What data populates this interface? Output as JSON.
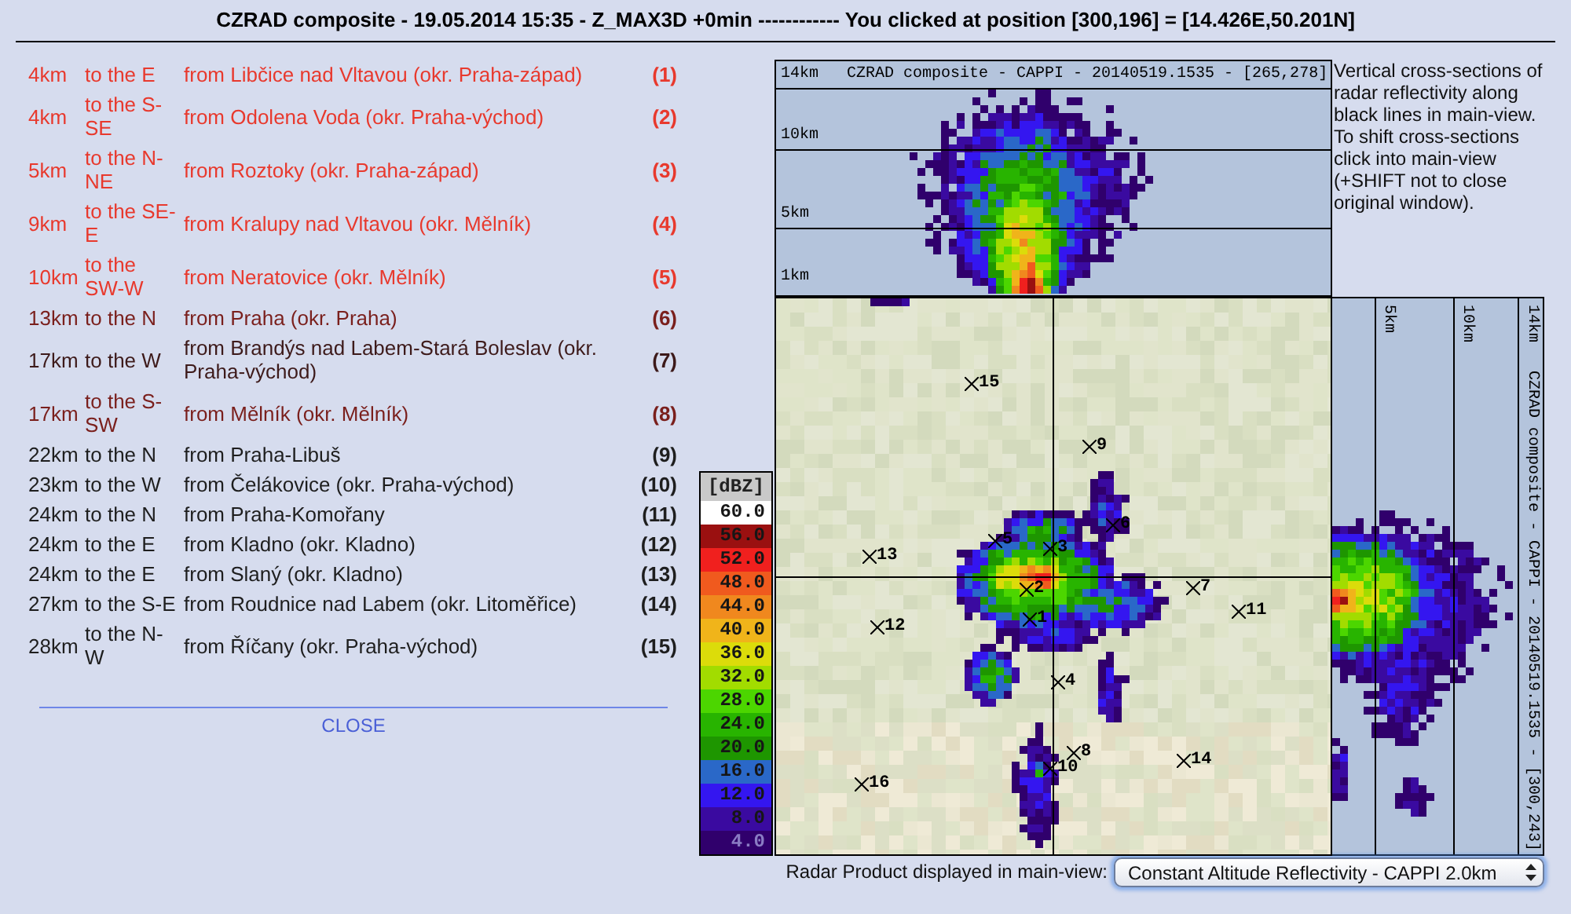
{
  "title": "CZRAD composite - 19.05.2014 15:35 - Z_MAX3D +0min ------------ You clicked at position [300,196] = [14.426E,50.201N]",
  "places": [
    {
      "distance": "4km",
      "direction": "to the E",
      "place": "from Libčice nad Vltavou (okr. Praha-západ)",
      "index": "(1)",
      "color": "#e8392d"
    },
    {
      "distance": "4km",
      "direction": "to the S-SE",
      "place": "from Odolena Voda (okr. Praha-východ)",
      "index": "(2)",
      "color": "#e8392d"
    },
    {
      "distance": "5km",
      "direction": "to the N-NE",
      "place": "from Roztoky (okr. Praha-západ)",
      "index": "(3)",
      "color": "#e8392d"
    },
    {
      "distance": "9km",
      "direction": "to the SE-E",
      "place": "from Kralupy nad Vltavou (okr. Mělník)",
      "index": "(4)",
      "color": "#e8392d"
    },
    {
      "distance": "10km",
      "direction": "to the SW-W",
      "place": "from Neratovice (okr. Mělník)",
      "index": "(5)",
      "color": "#e8392d"
    },
    {
      "distance": "13km",
      "direction": "to the N",
      "place": "from Praha (okr. Praha)",
      "index": "(6)",
      "color": "#7a1f1c"
    },
    {
      "distance": "17km",
      "direction": "to the W",
      "place": "from Brandýs nad Labem-Stará Boleslav (okr. Praha-východ)",
      "index": "(7)",
      "color": "#3d1a1a"
    },
    {
      "distance": "17km",
      "direction": "to the S-SW",
      "place": "from Mělník (okr. Mělník)",
      "index": "(8)",
      "color": "#7a1f1c"
    },
    {
      "distance": "22km",
      "direction": "to the N",
      "place": "from Praha-Libuš",
      "index": "(9)",
      "color": "#1e1e1e"
    },
    {
      "distance": "23km",
      "direction": "to the W",
      "place": "from Čelákovice (okr. Praha-východ)",
      "index": "(10)",
      "color": "#1e1e1e"
    },
    {
      "distance": "24km",
      "direction": "to the N",
      "place": "from Praha-Komořany",
      "index": "(11)",
      "color": "#1e1e1e"
    },
    {
      "distance": "24km",
      "direction": "to the E",
      "place": "from Kladno (okr. Kladno)",
      "index": "(12)",
      "color": "#1e1e1e"
    },
    {
      "distance": "24km",
      "direction": "to the E",
      "place": "from Slaný (okr. Kladno)",
      "index": "(13)",
      "color": "#1e1e1e"
    },
    {
      "distance": "27km",
      "direction": "to the S-E",
      "place": "from Roudnice nad Labem (okr. Litoměřice)",
      "index": "(14)",
      "color": "#1e1e1e"
    },
    {
      "distance": "28km",
      "direction": "to the N-W",
      "place": "from Říčany (okr. Praha-východ)",
      "index": "(15)",
      "color": "#1e1e1e"
    }
  ],
  "close_link": "CLOSE",
  "top_section": {
    "scale_top": "14km",
    "title": "CZRAD composite - CAPPI - 20140519.1535 - [265,278]",
    "altitude_labels": [
      "10km",
      "5km",
      "1km"
    ]
  },
  "description": "Vertical cross-sections of radar reflectivity along black lines in main-view. To shift cross-sections click into main-view (+SHIFT not to close original window).",
  "legend": {
    "title": "[dBZ]",
    "entries": [
      {
        "value": "60.0",
        "color": "#ffffff"
      },
      {
        "value": "56.0",
        "color": "#9a1010"
      },
      {
        "value": "52.0",
        "color": "#f0201e"
      },
      {
        "value": "48.0",
        "color": "#f05a1e"
      },
      {
        "value": "44.0",
        "color": "#f0881e"
      },
      {
        "value": "40.0",
        "color": "#f0b41a"
      },
      {
        "value": "36.0",
        "color": "#dcdc0a"
      },
      {
        "value": "32.0",
        "color": "#a2dc00"
      },
      {
        "value": "28.0",
        "color": "#4cd600"
      },
      {
        "value": "24.0",
        "color": "#28b400"
      },
      {
        "value": "20.0",
        "color": "#1e9600"
      },
      {
        "value": "16.0",
        "color": "#2a68c8"
      },
      {
        "value": "12.0",
        "color": "#3416f0"
      },
      {
        "value": "8.0",
        "color": "#3a0aa0"
      },
      {
        "value": "4.0",
        "color": "#30006c"
      }
    ]
  },
  "map": {
    "markers": [
      {
        "label": "15"
      },
      {
        "label": "9"
      },
      {
        "label": "6"
      },
      {
        "label": "13"
      },
      {
        "label": "5"
      },
      {
        "label": "3"
      },
      {
        "label": "2"
      },
      {
        "label": "7"
      },
      {
        "label": "12"
      },
      {
        "label": "1"
      },
      {
        "label": "11"
      },
      {
        "label": "4"
      },
      {
        "label": "10"
      },
      {
        "label": "8"
      },
      {
        "label": "14"
      },
      {
        "label": "16"
      }
    ]
  },
  "side_section": {
    "altitude_labels": [
      "5km",
      "10km"
    ],
    "scale_top": "14km",
    "title": "CZRAD composite - CAPPI - 20140519.1535 - [300,243]"
  },
  "product": {
    "label": "Radar Product displayed in main-view:",
    "value": "Constant Altitude Reflectivity - CAPPI 2.0km"
  }
}
